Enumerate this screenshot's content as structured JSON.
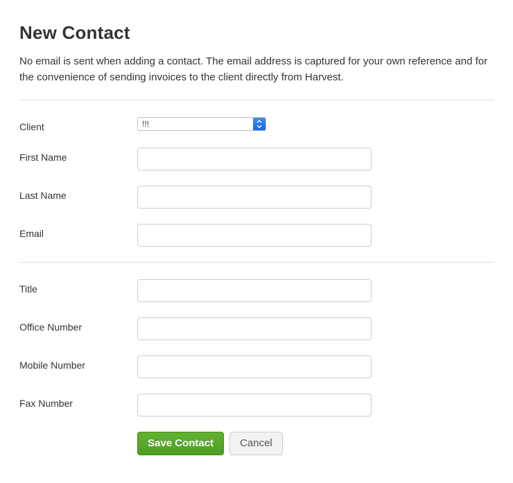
{
  "page": {
    "title": "New Contact",
    "description": "No email is sent when adding a contact. The email address is captured for your own reference and for the convenience of sending invoices to the client directly from Harvest."
  },
  "form": {
    "client": {
      "label": "Client",
      "selected": "!!!"
    },
    "first_name": {
      "label": "First Name",
      "value": ""
    },
    "last_name": {
      "label": "Last Name",
      "value": ""
    },
    "email": {
      "label": "Email",
      "value": ""
    },
    "title": {
      "label": "Title",
      "value": ""
    },
    "office_number": {
      "label": "Office Number",
      "value": ""
    },
    "mobile_number": {
      "label": "Mobile Number",
      "value": ""
    },
    "fax_number": {
      "label": "Fax Number",
      "value": ""
    }
  },
  "actions": {
    "save": "Save Contact",
    "cancel": "Cancel"
  },
  "colors": {
    "primary_green": "#5baa2a",
    "select_blue": "#2a78ea",
    "divider": "#dcdcdc"
  }
}
